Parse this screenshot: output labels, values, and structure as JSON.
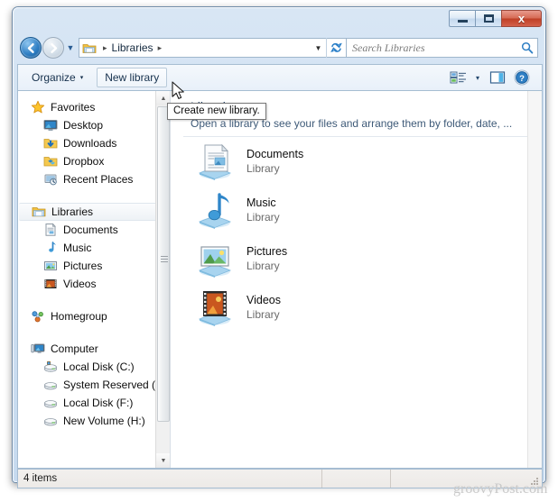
{
  "window": {
    "controls": {
      "minimize": "Minimize",
      "maximize": "Maximize",
      "close": "x"
    }
  },
  "navbar": {
    "back_label": "←",
    "forward_label": "→",
    "history_label": "▼",
    "breadcrumb": {
      "separator1": "▸",
      "root": "Libraries",
      "separator2": "▸",
      "dropdown": "▼"
    },
    "refresh_icon": "refresh-icon",
    "search": {
      "placeholder": "Search Libraries",
      "icon": "search-icon"
    }
  },
  "toolbar": {
    "organize_label": "Organize",
    "organize_caret": "▾",
    "new_library_label": "New library",
    "view_icon": "view-options-icon",
    "view_caret": "▾",
    "preview_icon": "preview-pane-icon",
    "help_icon": "help-icon",
    "help_glyph": "?"
  },
  "tooltip": {
    "text": "Create new library."
  },
  "sidebar": {
    "groups": [
      {
        "header": {
          "label": "Favorites",
          "icon": "star-icon"
        },
        "items": [
          {
            "label": "Desktop",
            "icon": "desktop-icon"
          },
          {
            "label": "Downloads",
            "icon": "downloads-icon"
          },
          {
            "label": "Dropbox",
            "icon": "dropbox-folder-icon"
          },
          {
            "label": "Recent Places",
            "icon": "recent-places-icon"
          }
        ]
      },
      {
        "header": {
          "label": "Libraries",
          "icon": "libraries-icon",
          "selected": true
        },
        "items": [
          {
            "label": "Documents",
            "icon": "documents-icon"
          },
          {
            "label": "Music",
            "icon": "music-icon"
          },
          {
            "label": "Pictures",
            "icon": "pictures-icon"
          },
          {
            "label": "Videos",
            "icon": "videos-icon"
          }
        ]
      },
      {
        "header": {
          "label": "Homegroup",
          "icon": "homegroup-icon"
        },
        "items": []
      },
      {
        "header": {
          "label": "Computer",
          "icon": "computer-icon"
        },
        "items": [
          {
            "label": "Local Disk (C:)",
            "icon": "system-drive-icon"
          },
          {
            "label": "System Reserved (E:",
            "icon": "drive-icon"
          },
          {
            "label": "Local Disk (F:)",
            "icon": "drive-icon"
          },
          {
            "label": "New Volume (H:)",
            "icon": "drive-icon"
          }
        ]
      }
    ],
    "scrollbar": {
      "up_arrow": "▲",
      "down_arrow": "▼"
    }
  },
  "content": {
    "title": "Libraries",
    "subtitle": "Open a library to see your files and arrange them by folder, date, ...",
    "items": [
      {
        "name": "Documents",
        "kind": "Library",
        "icon": "documents-library-icon"
      },
      {
        "name": "Music",
        "kind": "Library",
        "icon": "music-library-icon"
      },
      {
        "name": "Pictures",
        "kind": "Library",
        "icon": "pictures-library-icon"
      },
      {
        "name": "Videos",
        "kind": "Library",
        "icon": "videos-library-icon"
      }
    ]
  },
  "statusbar": {
    "item_count": "4 items"
  },
  "watermark": {
    "text": "groovyPost.com"
  },
  "colors": {
    "accent_blue": "#2f7fc4",
    "title_text": "#1f3f66",
    "close_red": "#bf3f26",
    "frame_blue": "#c6daef"
  }
}
